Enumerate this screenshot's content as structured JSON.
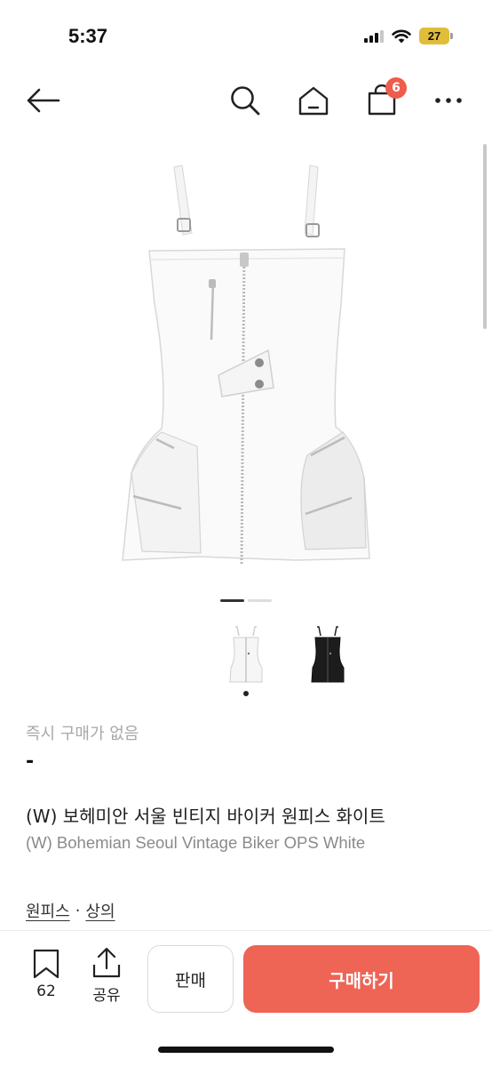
{
  "status_bar": {
    "time": "5:37",
    "battery": "27"
  },
  "nav": {
    "cart_count": "6"
  },
  "gallery": {
    "page_count": 2,
    "active_page": 1
  },
  "product": {
    "availability": "즉시 구매가 없음",
    "price": "-",
    "title_ko": "(W) 보헤미안 서울 빈티지 바이커 원피스 화이트",
    "title_en": "(W) Bohemian Seoul Vintage Biker OPS White",
    "categories": [
      "원피스",
      "상의"
    ],
    "category_separator": "·"
  },
  "bottom_bar": {
    "bookmark_count": "62",
    "share_label": "공유",
    "sell_label": "판매",
    "buy_label": "구매하기"
  },
  "colors": {
    "accent": "#ee6455",
    "badge": "#ee5c4c"
  },
  "icons": [
    "back-arrow-icon",
    "search-icon",
    "home-icon",
    "shopping-bag-icon",
    "more-icon",
    "bookmark-icon",
    "share-icon"
  ]
}
